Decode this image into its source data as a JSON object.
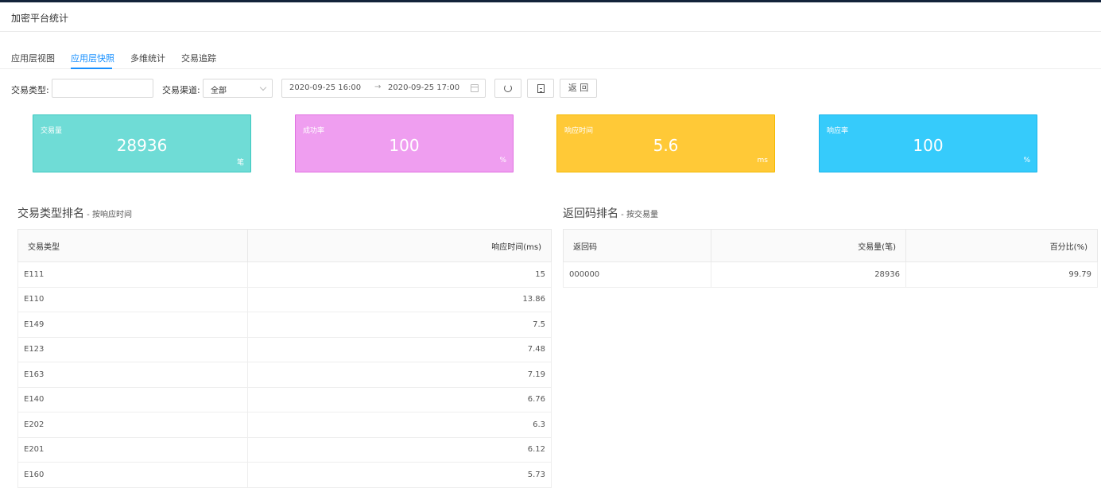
{
  "header": {
    "title": "加密平台统计"
  },
  "tabs": [
    {
      "label": "应用层视图",
      "active": false
    },
    {
      "label": "应用层快照",
      "active": true
    },
    {
      "label": "多维统计",
      "active": false
    },
    {
      "label": "交易追踪",
      "active": false
    }
  ],
  "filters": {
    "type_label": "交易类型:",
    "type_value": "",
    "channel_label": "交易渠道:",
    "channel_value": "全部",
    "date_start": "2020-09-25 16:00",
    "date_sep": "→",
    "date_end": "2020-09-25 17:00",
    "refresh_icon": "refresh-icon",
    "export_icon": "export-icon",
    "back_label": "返 回"
  },
  "cards": [
    {
      "label": "交易量",
      "value": "28936",
      "unit": "笔",
      "color": "#6fdcd6",
      "border": "#3cc8c0"
    },
    {
      "label": "成功率",
      "value": "100",
      "unit": "%",
      "color": "#ef9ef0",
      "border": "#e070e0"
    },
    {
      "label": "响应时间",
      "value": "5.6",
      "unit": "ms",
      "color": "#ffc937",
      "border": "#f5b900"
    },
    {
      "label": "响应率",
      "value": "100",
      "unit": "%",
      "color": "#36cbfb",
      "border": "#1ab4ea"
    }
  ],
  "left_section": {
    "title": "交易类型排名",
    "subtitle": " - 按响应时间",
    "columns": [
      "交易类型",
      "响应时间(ms)"
    ],
    "rows": [
      [
        "E111",
        "15"
      ],
      [
        "E110",
        "13.86"
      ],
      [
        "E149",
        "7.5"
      ],
      [
        "E123",
        "7.48"
      ],
      [
        "E163",
        "7.19"
      ],
      [
        "E140",
        "6.76"
      ],
      [
        "E202",
        "6.3"
      ],
      [
        "E201",
        "6.12"
      ],
      [
        "E160",
        "5.73"
      ]
    ]
  },
  "right_section": {
    "title": "返回码排名",
    "subtitle": " - 按交易量",
    "columns": [
      "返回码",
      "交易量(笔)",
      "百分比(%)"
    ],
    "rows": [
      [
        "000000",
        "28936",
        "99.79"
      ]
    ]
  }
}
